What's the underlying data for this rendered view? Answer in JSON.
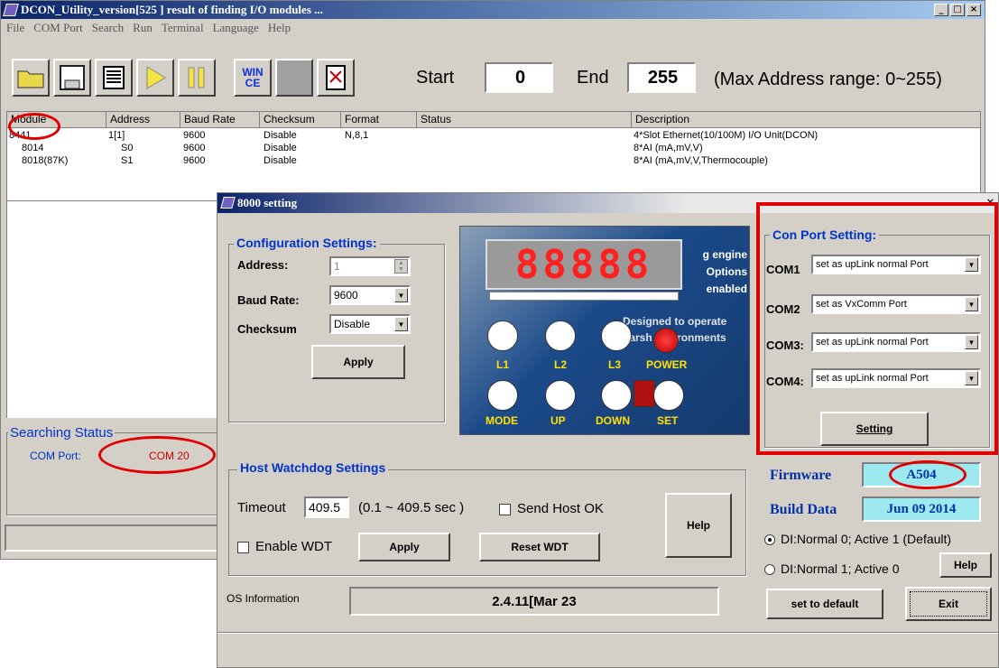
{
  "main_window": {
    "title": "DCON_Utility_version[525  ] result of finding I/O modules ...",
    "menu": [
      "File",
      "COM Port",
      "Search",
      "Run",
      "Terminal",
      "Language",
      "Help"
    ],
    "toolbar": {
      "wince_label": "WIN CE",
      "start_label": "Start",
      "start_value": "0",
      "end_label": "End",
      "end_value": "255",
      "range_text": "(Max Address range: 0~255)"
    },
    "table": {
      "headers": [
        "Module",
        "Address",
        "Baud Rate",
        "Checksum",
        "Format",
        "Status",
        "Description"
      ],
      "rows": [
        {
          "module": "8441",
          "address": "1[1]",
          "baud": "9600",
          "checksum": "Disable",
          "format": "N,8,1",
          "status": "",
          "description": "4*Slot Ethernet(10/100M) I/O Unit(DCON)"
        },
        {
          "module": "8014",
          "address": "S0",
          "baud": "9600",
          "checksum": "Disable",
          "format": "",
          "status": "",
          "description": "8*AI (mA,mV,V)"
        },
        {
          "module": "8018(87K)",
          "address": "S1",
          "baud": "9600",
          "checksum": "Disable",
          "format": "",
          "status": "",
          "description": "8*AI (mA,mV,V,Thermocouple)"
        }
      ]
    },
    "searching_status": {
      "label": "Searching Status",
      "com_port_label": "COM Port:",
      "com_port_value": "COM 20"
    }
  },
  "dialog": {
    "title": "8000 setting",
    "config": {
      "label": "Configuration Settings:",
      "address_label": "Address:",
      "address_value": "1",
      "baud_label": "Baud Rate:",
      "baud_value": "9600",
      "checksum_label": "Checksum",
      "checksum_value": "Disable",
      "apply": "Apply"
    },
    "panel": {
      "lcd_digits": "88888",
      "bg_text": [
        "g engine",
        "Options",
        "enabled",
        "Designed to operate",
        "harsh environments"
      ],
      "led_labels": [
        "L1",
        "L2",
        "L3",
        "POWER"
      ],
      "key_labels": [
        "MODE",
        "UP",
        "DOWN",
        "SET"
      ]
    },
    "com_port_setting": {
      "label": "Con Port Setting:",
      "ports": [
        {
          "name": "COM1",
          "value": "set as upLink normal Port"
        },
        {
          "name": "COM2",
          "value": "set as VxComm  Port"
        },
        {
          "name": "COM3:",
          "value": "set as upLink normal Port"
        },
        {
          "name": "COM4:",
          "value": "set as upLink normal Port"
        }
      ],
      "setting_button": "Setting"
    },
    "watchdog": {
      "label": "Host Watchdog Settings",
      "timeout_label": "Timeout",
      "timeout_value": "409.5",
      "range": "(0.1 ~ 409.5 sec )",
      "send_host_ok": "Send Host OK",
      "enable_wdt": "Enable WDT",
      "apply": "Apply",
      "reset_wdt": "Reset WDT",
      "help": "Help"
    },
    "firmware_label": "Firmware",
    "firmware_value": "A504",
    "build_label": "Build Data",
    "build_value": "Jun 09 2014",
    "di_option1": "DI:Normal 0;  Active 1 (Default)",
    "di_option2": "DI:Normal 1;  Active 0",
    "help": "Help",
    "os_label": "OS Information",
    "os_value": "2.4.11[Mar 23",
    "set_default": "set to default",
    "exit": "Exit"
  }
}
